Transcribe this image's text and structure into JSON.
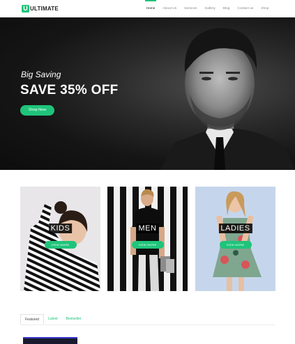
{
  "header": {
    "logo_letter": "U",
    "logo_text": "ULTIMATE",
    "nav": [
      "Home",
      "About Us",
      "Services",
      "Gallery",
      "Blog",
      "Contact us",
      "Shop"
    ],
    "nav_active": "Home"
  },
  "hero": {
    "subtitle": "Big Saving",
    "title": "SAVE 35% OFF",
    "button": "Shop Now"
  },
  "categories": [
    {
      "label": "KIDS",
      "button": "VIEW MORE"
    },
    {
      "label": "MEN",
      "button": "VIEW MORE"
    },
    {
      "label": "LADIES",
      "button": "VIEW MORE"
    }
  ],
  "tabs": [
    "Featured",
    "Latest",
    "Bestseller"
  ],
  "colors": {
    "accent": "#1fc47a",
    "hero_bg": "#151515"
  }
}
